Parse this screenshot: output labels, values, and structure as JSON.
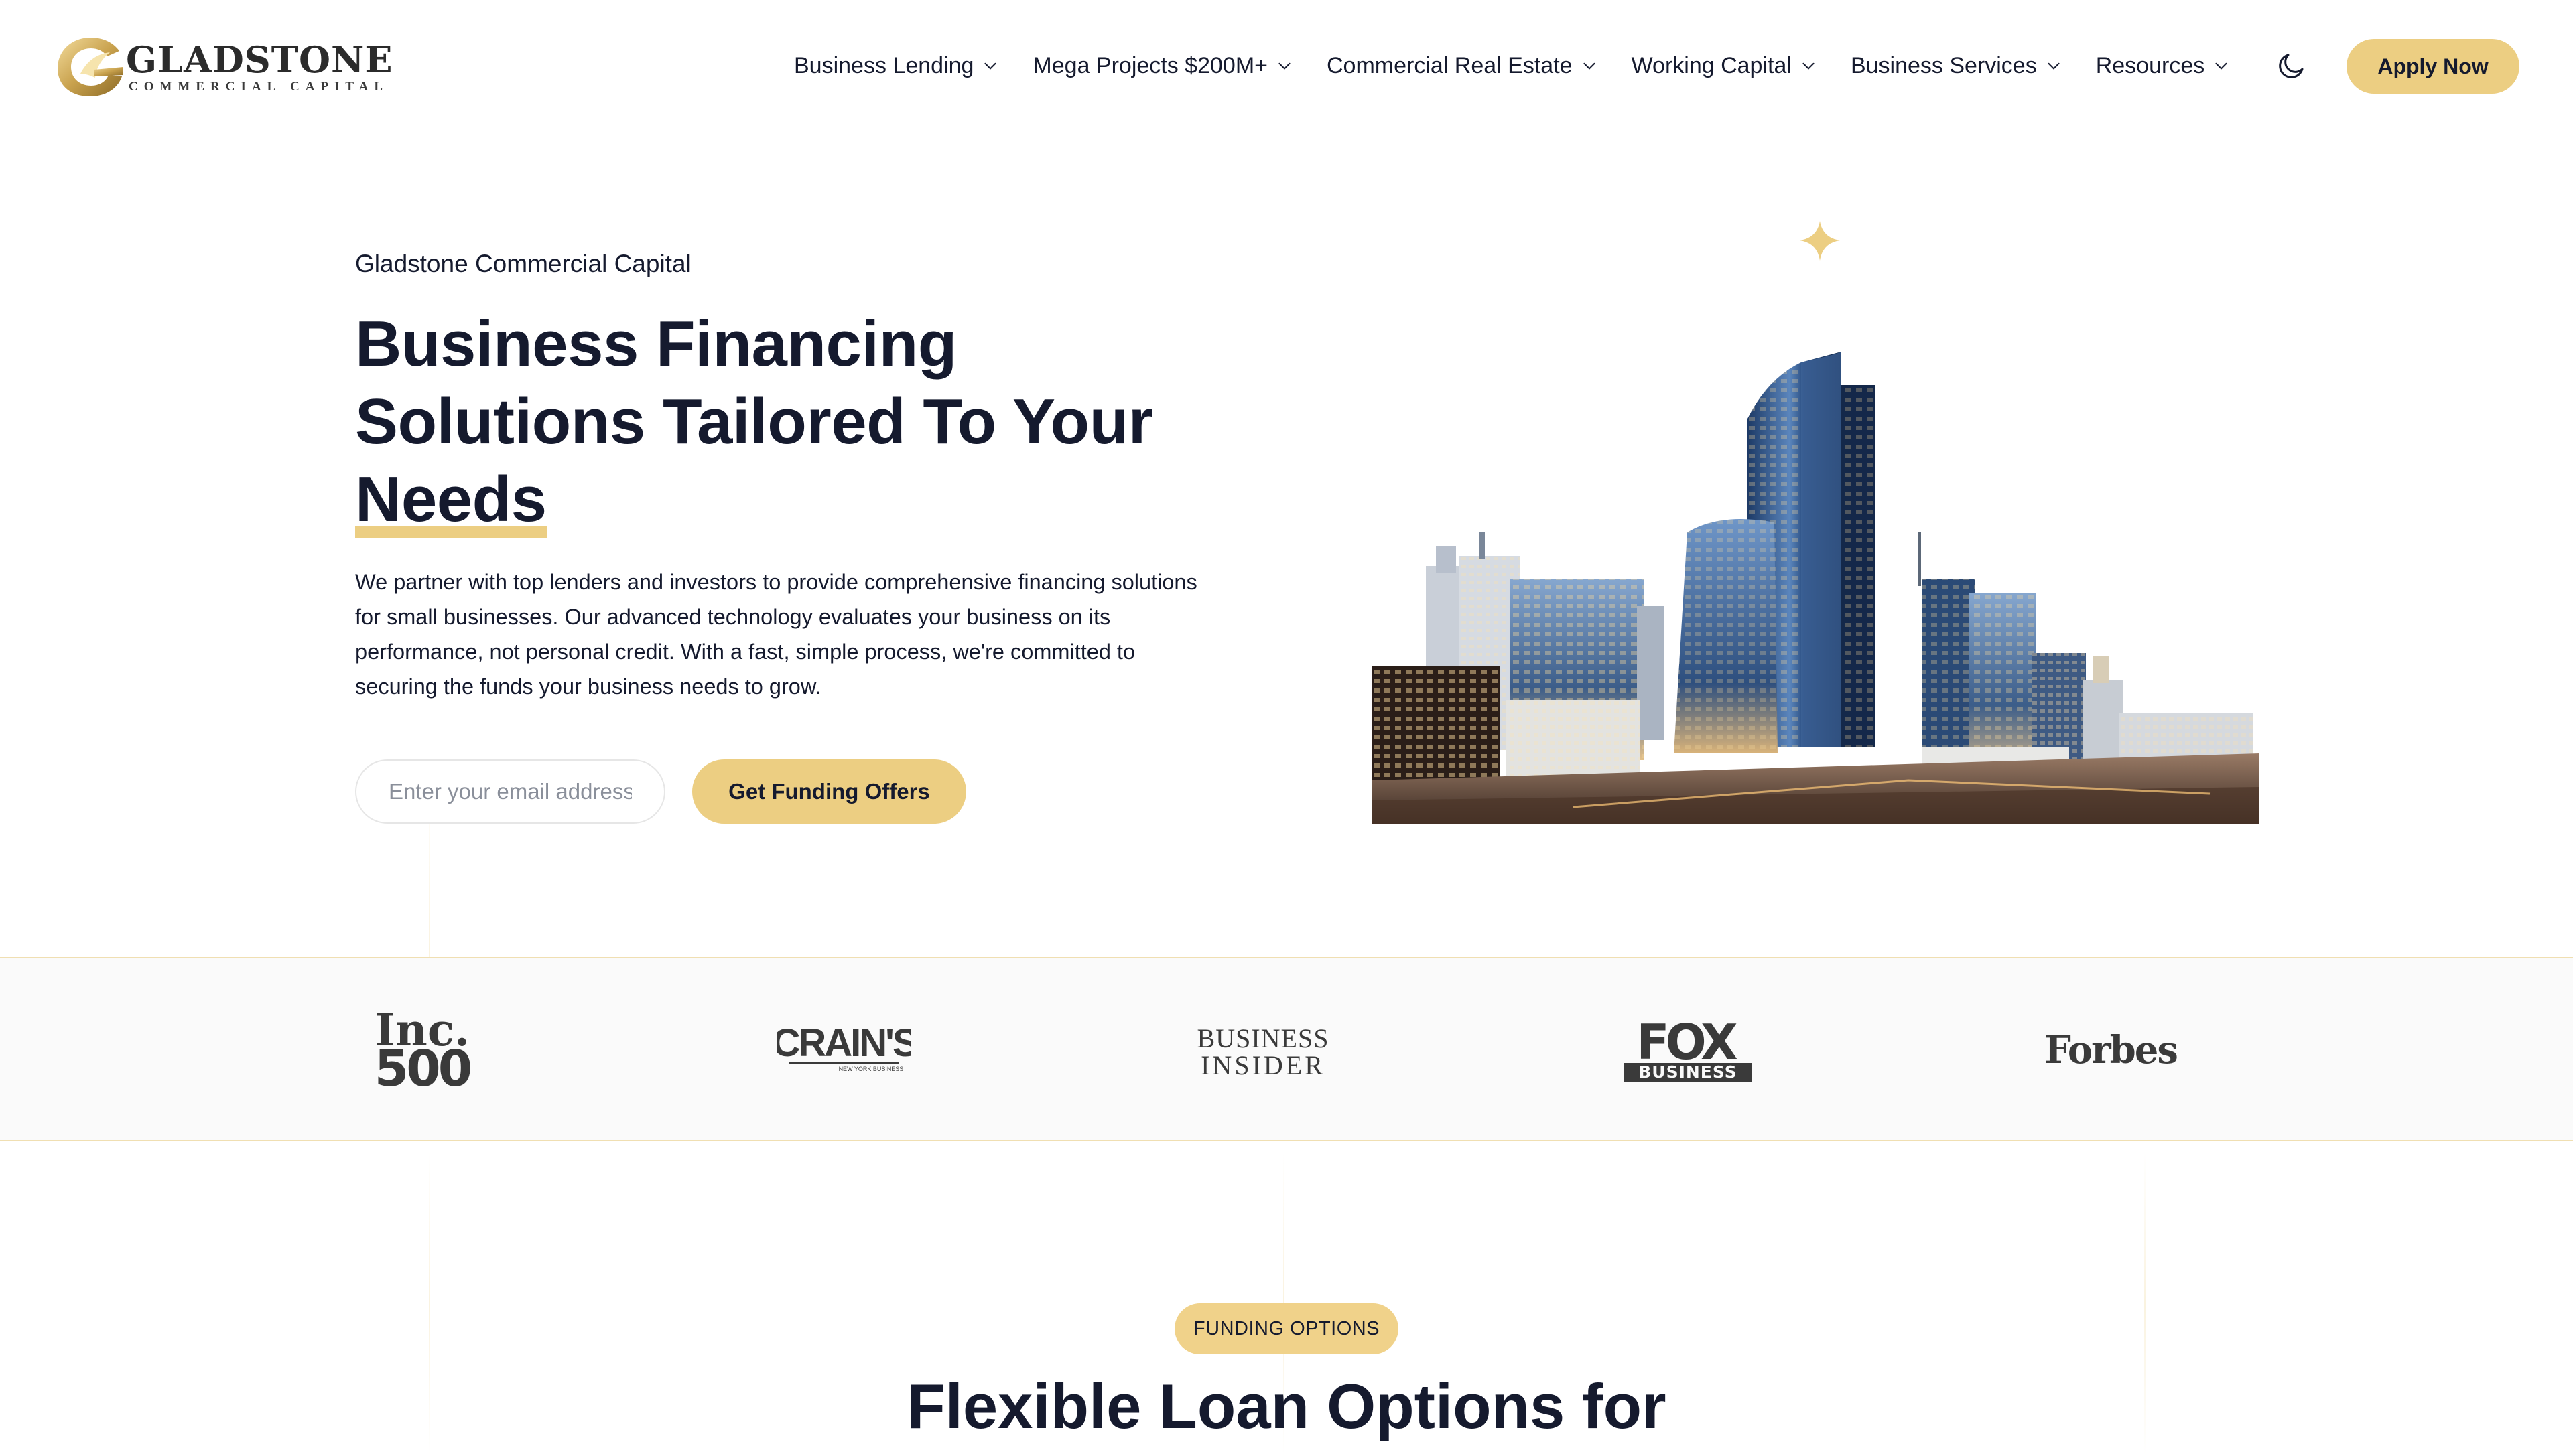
{
  "brand": {
    "name": "GLADSTONE",
    "subtitle": "COMMERCIAL CAPITAL",
    "accent_color": "#ecce82",
    "text_color": "#151a2e"
  },
  "nav": {
    "items": [
      {
        "label": "Business Lending",
        "icon": "chevron-down-icon"
      },
      {
        "label": "Mega Projects $200M+",
        "icon": "chevron-down-icon"
      },
      {
        "label": "Commercial Real Estate",
        "icon": "chevron-down-icon"
      },
      {
        "label": "Working Capital",
        "icon": "chevron-down-icon"
      },
      {
        "label": "Business Services",
        "icon": "chevron-down-icon"
      },
      {
        "label": "Resources",
        "icon": "chevron-down-icon"
      }
    ],
    "theme_toggle_icon": "moon-icon",
    "apply_label": "Apply Now"
  },
  "hero": {
    "eyebrow": "Gladstone Commercial Capital",
    "title_lines": [
      "Business Financing",
      "Solutions Tailored To Your",
      "Needs"
    ],
    "description": "We partner with top lenders and investors to provide comprehensive financing solutions for small businesses. Our advanced technology evaluates your business on its performance, not personal credit. With a fast, simple process, we're committed to securing the funds your business needs to grow.",
    "email_placeholder": "Enter your email address",
    "email_value": "",
    "cta_label": "Get Funding Offers",
    "image_icon": "city-skyline-image"
  },
  "press": {
    "logos": [
      {
        "name": "Inc. 500",
        "line1": "Inc.",
        "line2": "500"
      },
      {
        "name": "Crain's",
        "line1": "CRAIN'S",
        "line2": "NEW YORK BUSINESS"
      },
      {
        "name": "Business Insider",
        "line1": "BUSINESS",
        "line2": "INSIDER"
      },
      {
        "name": "Fox Business",
        "line1": "FOX",
        "line2": "BUSINESS"
      },
      {
        "name": "Forbes",
        "line1": "Forbes"
      }
    ]
  },
  "funding": {
    "badge": "FUNDING OPTIONS",
    "title": "Flexible Loan Options for"
  }
}
